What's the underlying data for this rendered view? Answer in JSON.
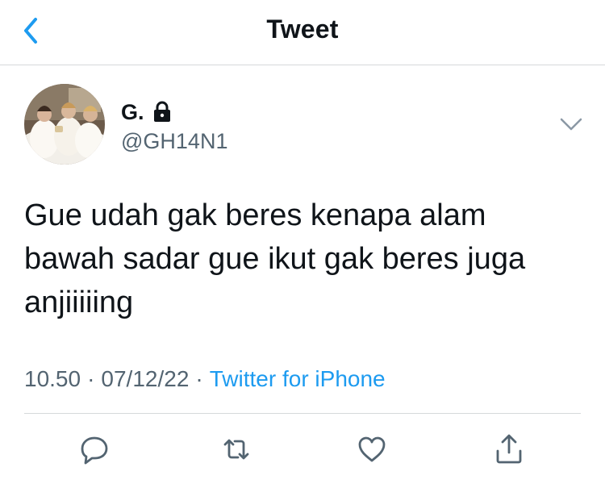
{
  "header": {
    "title": "Tweet",
    "back_icon": "chevron-left-icon"
  },
  "author": {
    "display_name": "G.",
    "handle": "@GH14N1",
    "protected_icon": "lock-icon"
  },
  "tweet": {
    "text": "Gue udah gak beres kenapa alam bawah sadar gue ikut gak beres juga anjiiiiing",
    "time": "10.50",
    "date": "07/12/22",
    "separator": "·",
    "client": "Twitter for iPhone"
  },
  "actions": [
    "reply-icon",
    "retweet-icon",
    "like-icon",
    "share-icon"
  ],
  "colors": {
    "accent": "#1d9bf0",
    "text": "#0f1419",
    "secondary_text": "#536471",
    "divider": "#d6d9db"
  }
}
